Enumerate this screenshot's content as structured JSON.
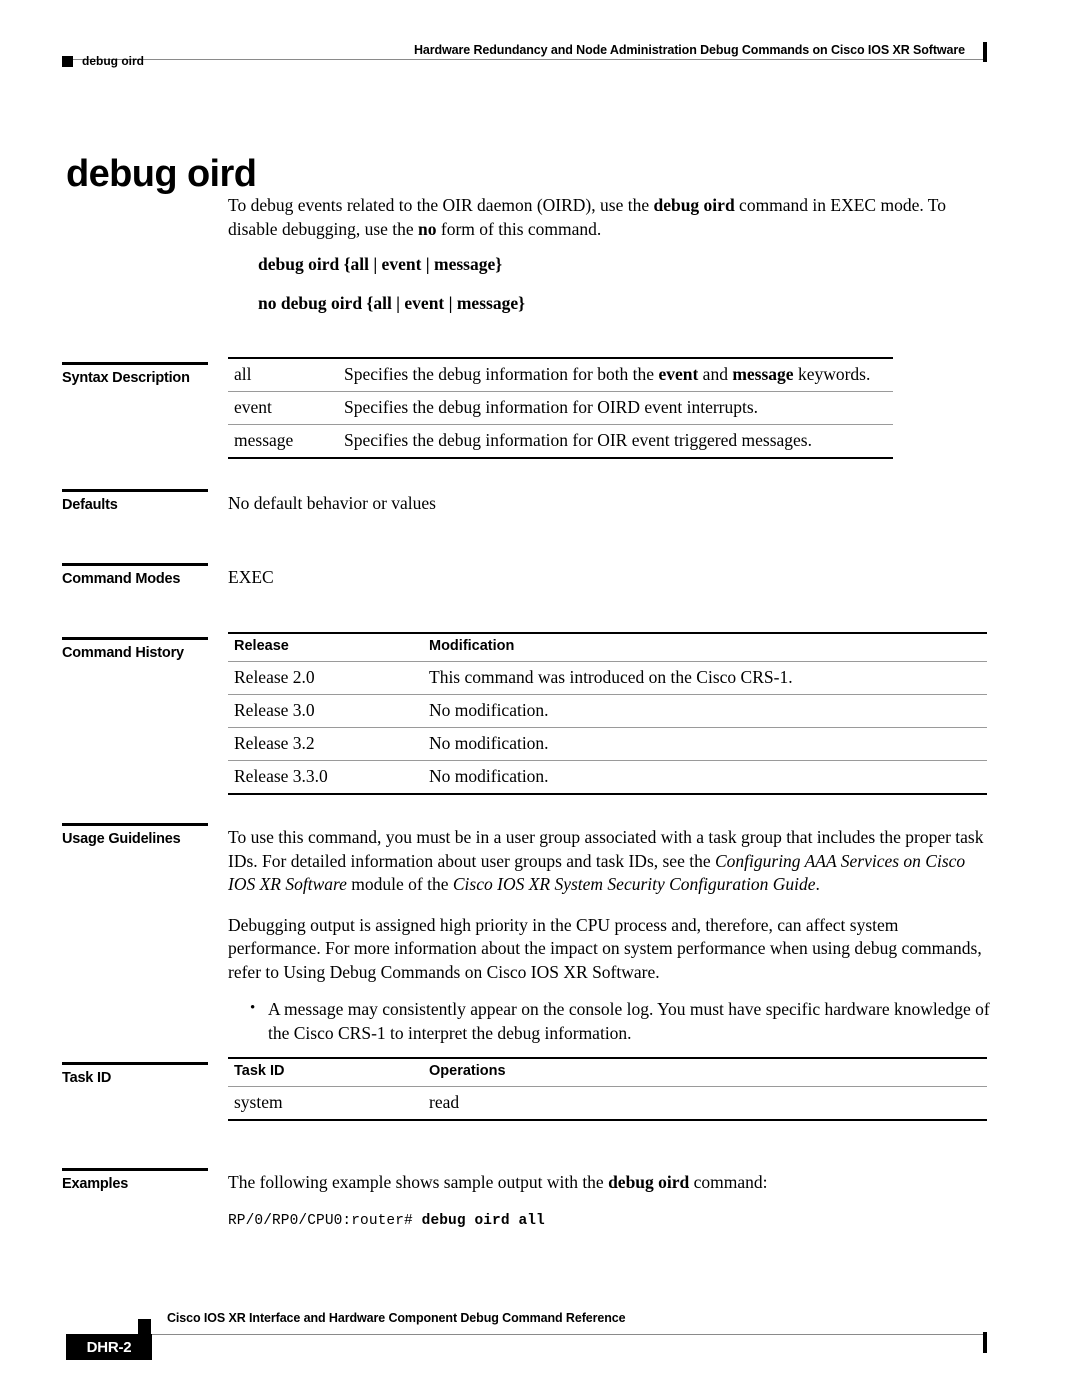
{
  "header": {
    "title": "Hardware Redundancy and Node Administration Debug Commands on Cisco IOS XR Software",
    "breadcrumb": "debug oird"
  },
  "page_title": "debug oird",
  "intro": {
    "part1": "To debug events related to the OIR daemon (OIRD), use the ",
    "bold1": "debug oird",
    "part2": " command in EXEC mode. To disable debugging, use the ",
    "bold2": "no",
    "part3": " form of this command."
  },
  "syntax_lines": [
    "debug oird {all | event | message}",
    "no debug oird {all | event | message}"
  ],
  "sections": {
    "syntax_description": "Syntax Description",
    "defaults": "Defaults",
    "command_modes": "Command Modes",
    "command_history": "Command History",
    "usage_guidelines": "Usage Guidelines",
    "task_id": "Task ID",
    "examples": "Examples"
  },
  "syntax_description": {
    "rows": [
      {
        "keyword": "all",
        "desc_part1": "Specifies the debug information for both the ",
        "desc_bold1": "event",
        "desc_part2": " and ",
        "desc_bold2": "message",
        "desc_part3": " keywords."
      },
      {
        "keyword": "event",
        "desc_part1": "Specifies the debug information for OIRD event interrupts.",
        "desc_bold1": "",
        "desc_part2": "",
        "desc_bold2": "",
        "desc_part3": ""
      },
      {
        "keyword": "message",
        "desc_part1": "Specifies the debug information for OIR event triggered messages.",
        "desc_bold1": "",
        "desc_part2": "",
        "desc_bold2": "",
        "desc_part3": ""
      }
    ]
  },
  "defaults": {
    "text": "No default behavior or values"
  },
  "command_modes": {
    "text": "EXEC"
  },
  "command_history": {
    "headers": {
      "release": "Release",
      "modification": "Modification"
    },
    "rows": [
      {
        "release": "Release 2.0",
        "modification": "This command was introduced on the Cisco CRS-1."
      },
      {
        "release": "Release 3.0",
        "modification": "No modification."
      },
      {
        "release": "Release 3.2",
        "modification": "No modification."
      },
      {
        "release": "Release 3.3.0",
        "modification": "No modification."
      }
    ]
  },
  "usage_guidelines": {
    "p1_part1": "To use this command, you must be in a user group associated with a task group that includes the proper task IDs. For detailed information about user groups and task IDs, see the ",
    "p1_ital1": "Configuring AAA Services on Cisco IOS XR Software",
    "p1_part2": " module of the ",
    "p1_ital2": "Cisco IOS XR System Security Configuration Guide",
    "p1_part3": ".",
    "p2": "Debugging output is assigned high priority in the CPU process and, therefore, can affect system performance. For more information about the impact on system performance when using debug commands, refer to Using Debug Commands on Cisco IOS XR Software.",
    "bullets": [
      "A message may consistently appear on the console log. You must have specific hardware knowledge of the Cisco CRS-1 to interpret the debug information."
    ]
  },
  "task_id": {
    "headers": {
      "task_id": "Task ID",
      "operations": "Operations"
    },
    "rows": [
      {
        "task_id": "system",
        "operations": "read"
      }
    ]
  },
  "examples": {
    "intro_part1": "The following example shows sample output with the ",
    "intro_bold": "debug oird",
    "intro_part2": " command:",
    "cli_prompt": "RP/0/RP0/CPU0:router# ",
    "cli_command": "debug oird all"
  },
  "footer": {
    "title": "Cisco IOS XR Interface and Hardware Component Debug Command Reference",
    "page_number": "DHR-2"
  }
}
